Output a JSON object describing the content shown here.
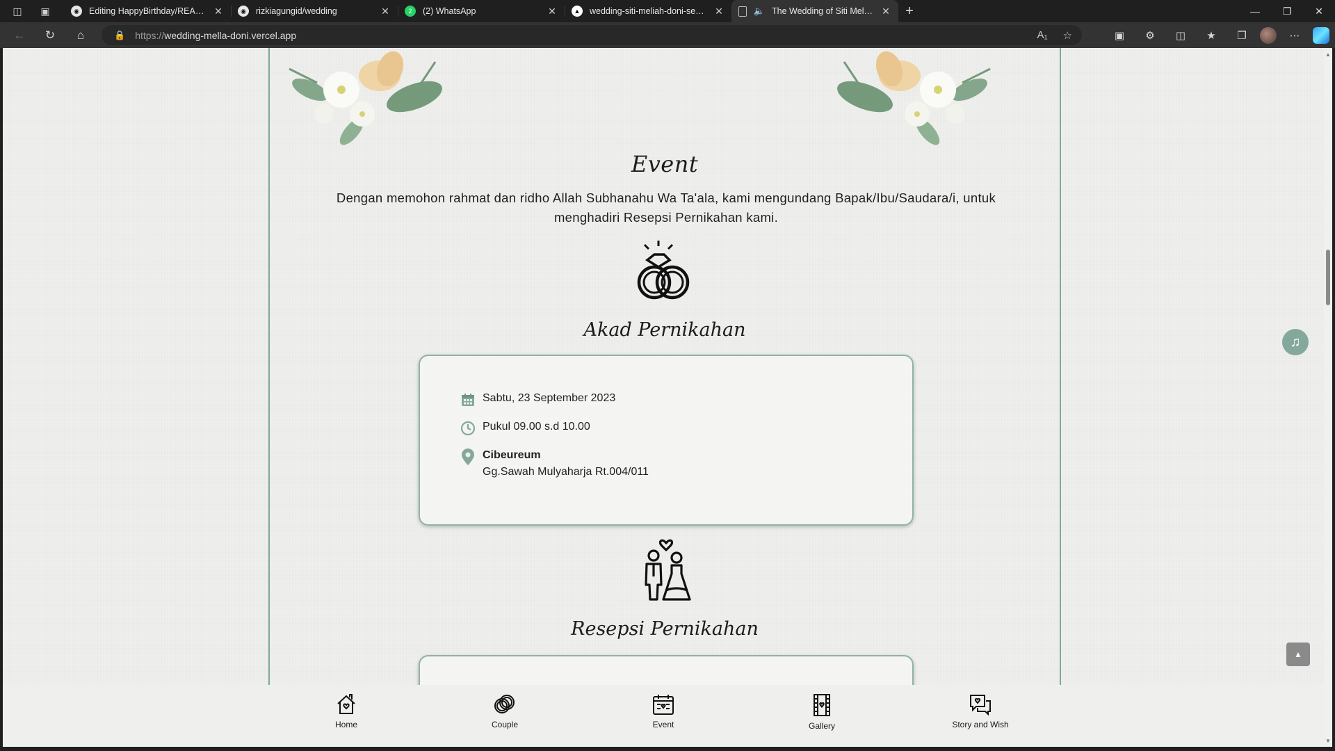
{
  "browser": {
    "tabs": [
      {
        "title": "Editing HappyBirthday/README",
        "icon": "github-icon",
        "active": false
      },
      {
        "title": "rizkiagungid/wedding",
        "icon": "github-icon",
        "active": false
      },
      {
        "title": "(2) WhatsApp",
        "icon": "whatsapp-icon",
        "active": false
      },
      {
        "title": "wedding-siti-meliah-doni-setiaw",
        "icon": "vercel-icon",
        "active": false
      },
      {
        "title": "The Wedding of Siti Meliah",
        "icon": "page-icon",
        "active": true
      }
    ],
    "url_protocol": "https://",
    "url_host": "wedding-mella-doni.vercel.app"
  },
  "page": {
    "event_title": "Event",
    "intro": "Dengan memohon rahmat dan ridho Allah Subhanahu Wa Ta'ala, kami mengundang Bapak/Ibu/Saudara/i, untuk menghadiri Resepsi Pernikahan kami.",
    "akad": {
      "title": "Akad Pernikahan",
      "date": "Sabtu, 23 September 2023",
      "time": "Pukul 09.00 s.d 10.00",
      "place_name": "Cibeureum",
      "place_address": "Gg.Sawah Mulyaharja Rt.004/011"
    },
    "resepsi": {
      "title": "Resepsi Pernikahan"
    }
  },
  "bottom_nav": {
    "home": "Home",
    "couple": "Couple",
    "event": "Event",
    "gallery": "Gallery",
    "story": "Story and Wish"
  },
  "colors": {
    "accent": "#84a99c",
    "border": "#7fa89a"
  }
}
